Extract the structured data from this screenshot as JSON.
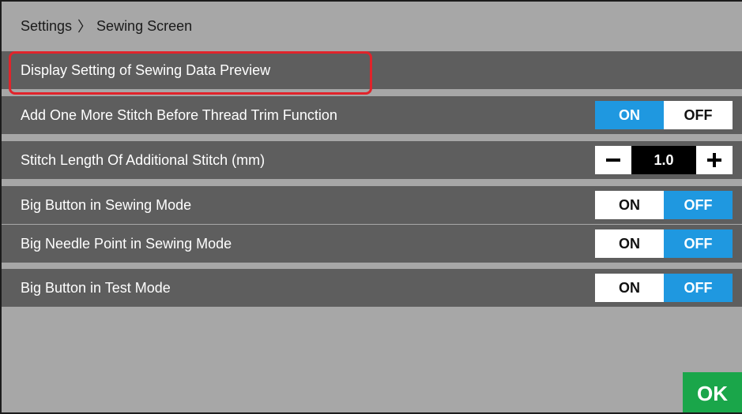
{
  "breadcrumb": {
    "root": "Settings",
    "separator": "〉",
    "current": "Sewing Screen"
  },
  "section": {
    "title": "Display Setting of Sewing Data Preview"
  },
  "settings": [
    {
      "label": "Add One More Stitch Before Thread Trim Function",
      "on_label": "ON",
      "off_label": "OFF",
      "selected": "ON"
    },
    {
      "label": "Stitch Length Of Additional Stitch (mm)",
      "value": "1.0",
      "minus_icon": "minus-icon",
      "plus_icon": "plus-icon"
    },
    {
      "label": "Big Button in Sewing Mode",
      "on_label": "ON",
      "off_label": "OFF",
      "selected": "OFF"
    },
    {
      "label": "Big Needle Point in Sewing Mode",
      "on_label": "ON",
      "off_label": "OFF",
      "selected": "OFF"
    },
    {
      "label": "Big Button in Test Mode",
      "on_label": "ON",
      "off_label": "OFF",
      "selected": "OFF"
    }
  ],
  "footer": {
    "ok_label": "OK"
  },
  "colors": {
    "background": "#a7a7a7",
    "row": "#5e5e5e",
    "active_toggle": "#1f98e0",
    "ok_button": "#1aa64a",
    "highlight": "#e0242b"
  }
}
